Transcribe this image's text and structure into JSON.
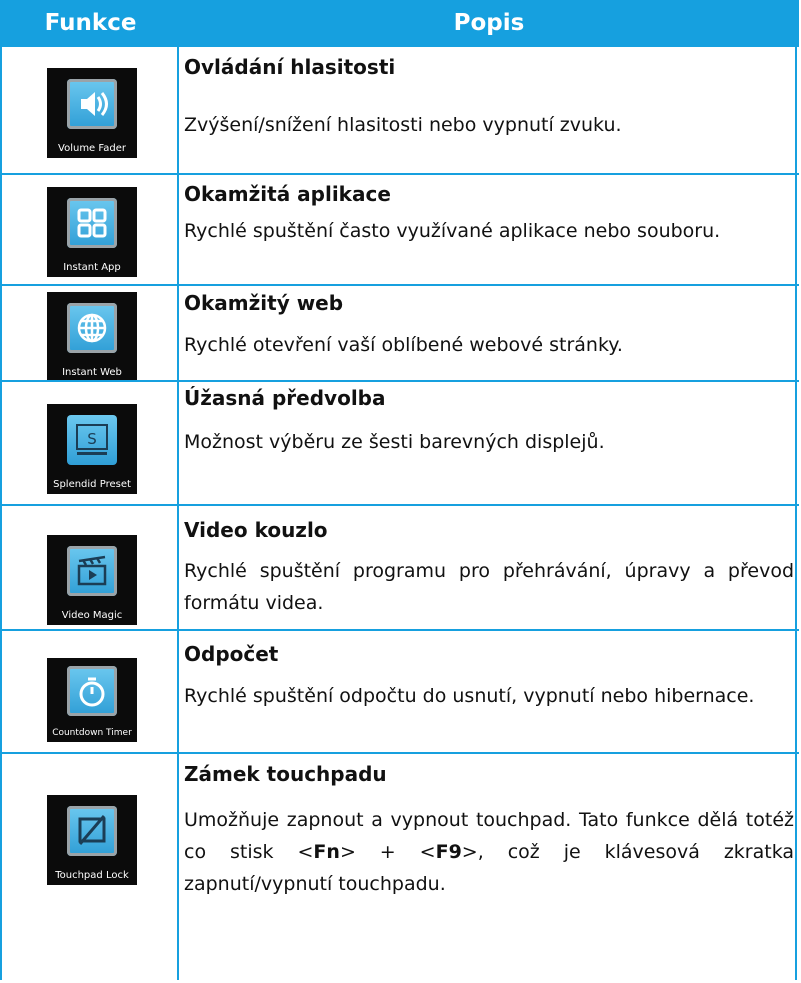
{
  "header": {
    "col1": "Funkce",
    "col2": "Popis"
  },
  "rows": [
    {
      "icon": "volume-icon",
      "icon_label": "Volume Fader",
      "title": "Ovládání hlasitosti",
      "desc": "Zvýšení/snížení hlasitosti nebo vypnutí zvuku."
    },
    {
      "icon": "app-grid-icon",
      "icon_label": "Instant App",
      "title": "Okamžitá aplikace",
      "desc": "Rychlé spuštění často využívané aplikace nebo souboru."
    },
    {
      "icon": "globe-icon",
      "icon_label": "Instant Web",
      "title": "Okamžitý web",
      "desc": "Rychlé otevření vaší oblíbené webové stránky."
    },
    {
      "icon": "splendid-icon",
      "icon_label": "Splendid Preset",
      "title": "Úžasná předvolba",
      "desc": "Možnost výběru ze šesti barevných displejů."
    },
    {
      "icon": "clapperboard-icon",
      "icon_label": "Video Magic",
      "title": "Video kouzlo",
      "desc": "Rychlé spuštění programu pro přehrávání, úpravy a převod formátu videa."
    },
    {
      "icon": "stopwatch-icon",
      "icon_label": "Countdown Timer",
      "title": "Odpočet",
      "desc": "Rychlé spuštění odpočtu do usnutí, vypnutí nebo hibernace."
    },
    {
      "icon": "touchpad-lock-icon",
      "icon_label": "Touchpad Lock",
      "title": "Zámek touchpadu",
      "desc_parts": {
        "a": "Umožňuje zapnout a vypnout touchpad. Tato funkce dělá totéž co stisk <",
        "fn": "Fn",
        "b": "> + <",
        "f9": "F9",
        "c": ">, což je klávesová zkratka zapnutí/vypnutí touchpadu."
      }
    }
  ],
  "colors": {
    "accent": "#16a0df",
    "icon_bg": "#0b0b0b",
    "text": "#111111"
  }
}
